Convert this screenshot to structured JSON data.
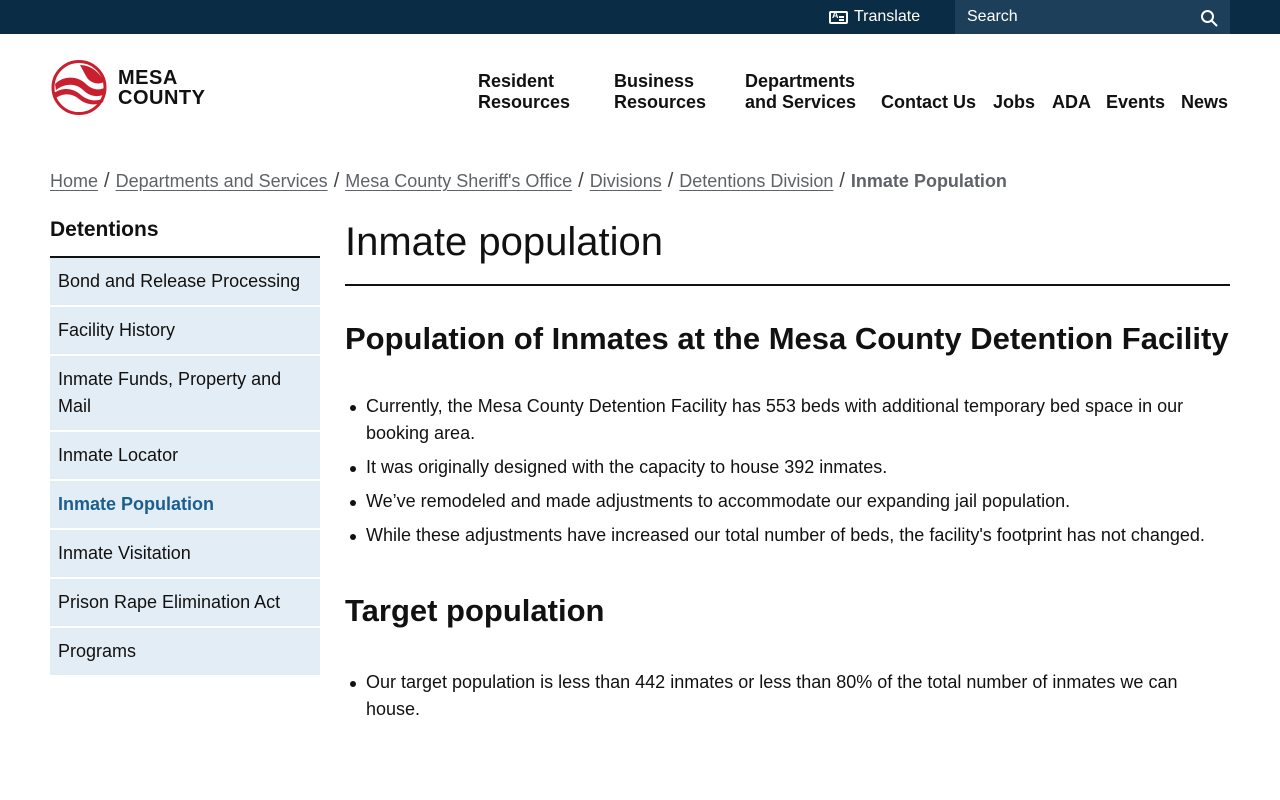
{
  "topbar": {
    "translate_label": "Translate",
    "search_placeholder": "Search"
  },
  "header": {
    "logo_line1": "MESA",
    "logo_line2": "COUNTY",
    "nav": [
      {
        "line1": "Resident",
        "line2": "Resources"
      },
      {
        "line1": "Business",
        "line2": "Resources"
      },
      {
        "line1": "Departments",
        "line2": "and Services"
      },
      {
        "label": "Contact Us"
      },
      {
        "label": "Jobs"
      },
      {
        "label": "ADA"
      },
      {
        "label": "Events"
      },
      {
        "label": "News"
      }
    ]
  },
  "breadcrumb": [
    "Home",
    "Departments and Services",
    "Mesa County Sheriff's Office",
    "Divisions",
    "Detentions Division",
    "Inmate Population"
  ],
  "sidebar": {
    "title": "Detentions",
    "items": [
      {
        "label": "Bond and Release Processing"
      },
      {
        "label": "Facility History"
      },
      {
        "label": "Inmate Funds, Property and Mail"
      },
      {
        "label": "Inmate Locator"
      },
      {
        "label": "Inmate Population",
        "active": true
      },
      {
        "label": "Inmate Visitation"
      },
      {
        "label": "Prison Rape Elimination Act"
      },
      {
        "label": "Programs"
      }
    ]
  },
  "main": {
    "title": "Inmate population",
    "section1": {
      "heading": "Population of Inmates at the Mesa County Detention Facility",
      "bullets": [
        "Currently, the Mesa County Detention Facility has 553 beds with additional temporary bed space in our booking area.",
        "It was originally designed with the capacity to house 392 inmates.",
        "We’ve remodeled and made adjustments to accommodate our expanding jail population.",
        "While these adjustments have increased our total number of beds, the facility's footprint has not changed."
      ]
    },
    "section2": {
      "heading": "Target population",
      "bullets": [
        "Our target population is less than 442 inmates or less than 80% of the total number of inmates we can house."
      ]
    }
  },
  "colors": {
    "topbar": "#0a2c45",
    "search_bg": "#1e3f5a",
    "brand_red": "#c8202f",
    "sidebar_bg": "#e3edf5",
    "active_link": "#1b5e8f"
  }
}
